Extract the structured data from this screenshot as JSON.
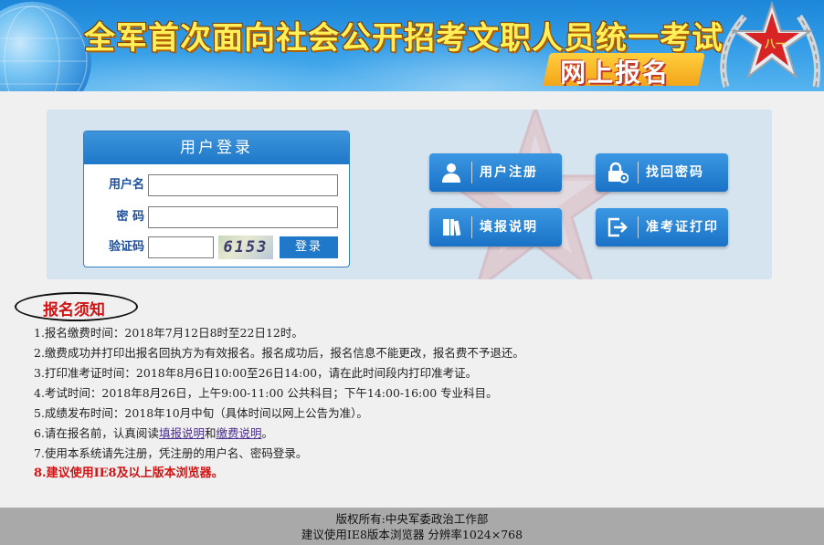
{
  "banner": {
    "title": "全军首次面向社会公开招考文职人员统一考试",
    "subtitle": "网上报名"
  },
  "login": {
    "header": "用户登录",
    "username_label": "用户名",
    "username_value": "",
    "password_label": "密 码",
    "password_value": "",
    "captcha_label": "验证码",
    "captcha_value": "",
    "captcha_image_text": "6153",
    "submit_label": "登录"
  },
  "actions": {
    "register": {
      "label": "用户注册",
      "icon": "user-icon"
    },
    "recover_password": {
      "label": "找回密码",
      "icon": "lock-gear-icon"
    },
    "fill_guide": {
      "label": "填报说明",
      "icon": "book-icon"
    },
    "admission_print": {
      "label": "准考证打印",
      "icon": "exit-arrow-icon"
    }
  },
  "notice": {
    "title": "报名须知",
    "items": [
      {
        "text": "1.报名缴费时间：2018年7月12日8时至22日12时。"
      },
      {
        "text": "2.缴费成功并打印出报名回执方为有效报名。报名成功后，报名信息不能更改，报名费不予退还。"
      },
      {
        "text": "3.打印准考证时间：2018年8月6日10:00至26日14:00，请在此时间段内打印准考证。"
      },
      {
        "text": "4.考试时间：2018年8月26日，上午9:00-11:00 公共科目；下午14:00-16:00 专业科目。"
      },
      {
        "text": "5.成绩发布时间：2018年10月中旬（具体时间以网上公告为准）。"
      },
      {
        "prefix": "6.请在报名前，认真阅读",
        "link1": "填报说明",
        "mid": "和",
        "link2": "缴费说明",
        "suffix": "。"
      },
      {
        "text": "7.使用本系统请先注册，凭注册的用户名、密码登录。"
      },
      {
        "text": "8.建议使用IE8及以上版本浏览器。"
      }
    ]
  },
  "footer": {
    "line1": "版权所有:中央军委政治工作部",
    "line2": "建议使用IE8版本浏览器 分辨率1024×768"
  },
  "colors": {
    "banner_blue": "#2f9ae6",
    "button_blue": "#1f78c8",
    "panel_bg": "#d6e4f0",
    "notice_red": "#d01414",
    "footer_gray": "#a9a9a9"
  }
}
